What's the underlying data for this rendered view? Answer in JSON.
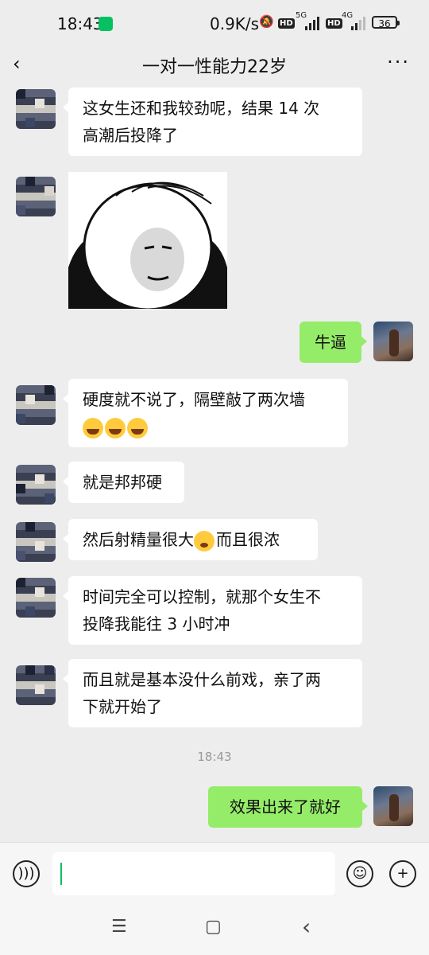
{
  "status_bar": {
    "time": "18:43",
    "network_speed": "0.9K/s",
    "sim1_label": "5G",
    "sim2_label": "4G",
    "hd_label": "HD",
    "battery": "36"
  },
  "header": {
    "back_glyph": "‹",
    "title": "一对一性能力22岁",
    "more_glyph": "···"
  },
  "messages": [
    {
      "text": "这女生还和我较劲呢，结果 14 次\n高潮后投降了"
    },
    {
      "text": "牛逼"
    },
    {
      "text": "硬度就不说了，隔壁敲了两次墙"
    },
    {
      "text": "就是邦邦硬"
    },
    {
      "text_before": "然后射精量很大",
      "text_after": "而且很浓"
    },
    {
      "text": "时间完全可以控制，就那个女生不\n投降我能往 3 小时冲"
    },
    {
      "text": "而且就是基本没什么前戏，亲了两\n下就开始了"
    },
    {
      "text": "效果出来了就好"
    }
  ],
  "timestamp": "18:43",
  "input_bar": {
    "voice_icon": "voice-icon",
    "emoji_icon": "emoji-icon",
    "plus_icon": "plus-icon"
  },
  "system_nav": {
    "menu": "☰",
    "home": "▢",
    "back": "‹"
  },
  "colors": {
    "outgoing_bubble": "#95ec69",
    "incoming_bubble": "#ffffff",
    "background": "#ededed"
  }
}
